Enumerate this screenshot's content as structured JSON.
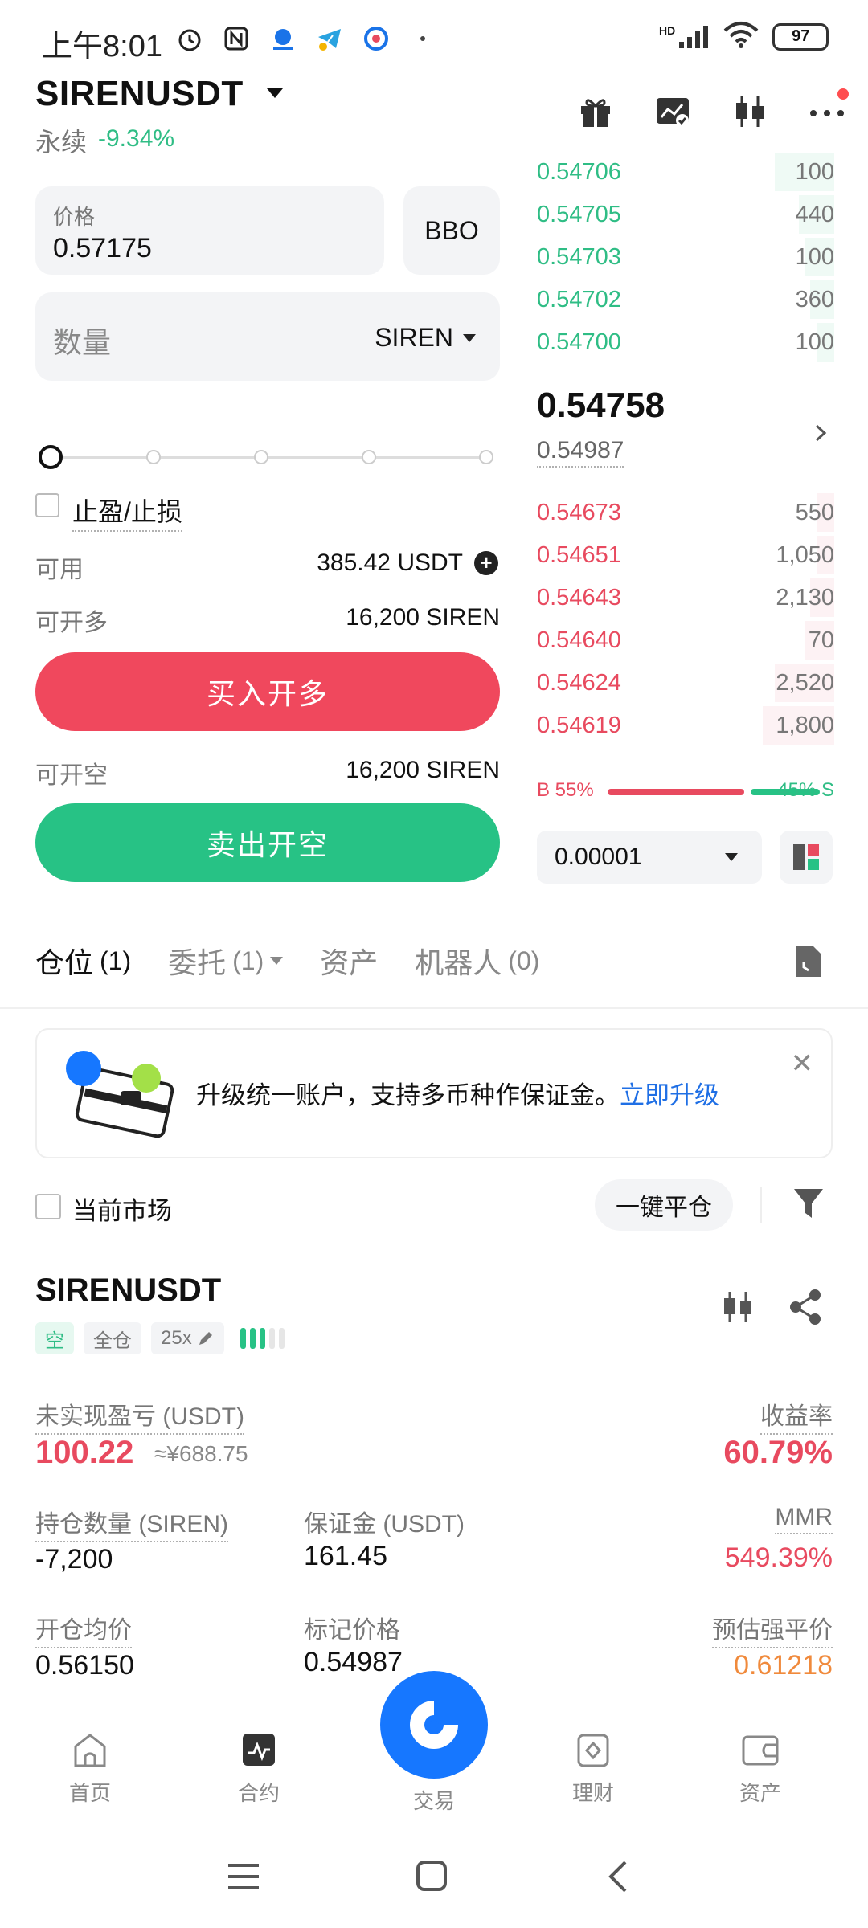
{
  "status_bar": {
    "time": "上午8:01",
    "battery": "97",
    "network": "HD"
  },
  "header": {
    "pair": "SIRENUSDT",
    "type": "永续",
    "change": "-9.34%"
  },
  "order_form": {
    "price_label": "价格",
    "price_value": "0.57175",
    "bbo_label": "BBO",
    "qty_placeholder": "数量",
    "qty_unit": "SIREN",
    "tpsl_label": "止盈/止损",
    "available_label": "可用",
    "available_value": "385.42 USDT",
    "long_label": "可开多",
    "long_value": "16,200 SIREN",
    "buy_label": "买入开多",
    "short_label": "可开空",
    "short_value": "16,200 SIREN",
    "sell_label": "卖出开空"
  },
  "order_book": {
    "asks_top": [
      {
        "price": "0.54706",
        "qty": "100",
        "depth": 0.2
      },
      {
        "price": "0.54705",
        "qty": "440",
        "depth": 0.12
      },
      {
        "price": "0.54703",
        "qty": "100",
        "depth": 0.1
      },
      {
        "price": "0.54702",
        "qty": "360",
        "depth": 0.08
      },
      {
        "price": "0.54700",
        "qty": "100",
        "depth": 0.06
      }
    ],
    "last_price": "0.54758",
    "mark_price": "0.54987",
    "bids": [
      {
        "price": "0.54673",
        "qty": "550",
        "depth": 0.06
      },
      {
        "price": "0.54651",
        "qty": "1,050",
        "depth": 0.06
      },
      {
        "price": "0.54643",
        "qty": "2,130",
        "depth": 0.08
      },
      {
        "price": "0.54640",
        "qty": "70",
        "depth": 0.1
      },
      {
        "price": "0.54624",
        "qty": "2,520",
        "depth": 0.2
      },
      {
        "price": "0.54619",
        "qty": "1,800",
        "depth": 0.24
      }
    ],
    "ratio_b": "B 55%",
    "ratio_s": "45% S",
    "tick_size": "0.00001"
  },
  "tabs": [
    {
      "label": "仓位",
      "count": "(1)",
      "active": true,
      "dropdown": false
    },
    {
      "label": "委托",
      "count": "(1)",
      "active": false,
      "dropdown": true
    },
    {
      "label": "资产",
      "count": "",
      "active": false,
      "dropdown": false
    },
    {
      "label": "机器人",
      "count": "(0)",
      "active": false,
      "dropdown": false
    }
  ],
  "banner": {
    "text": "升级统一账户，支持多币种作保证金。",
    "link": "立即升级"
  },
  "filters": {
    "current_market": "当前市场",
    "close_all": "一键平仓"
  },
  "position": {
    "symbol": "SIRENUSDT",
    "side_tag": "空",
    "margin_mode": "全仓",
    "leverage": "25x",
    "upnl_label": "未实现盈亏 (USDT)",
    "upnl_value": "100.22",
    "upnl_cny": "≈¥688.75",
    "roe_label": "收益率",
    "roe_value": "60.79%",
    "size_label": "持仓数量 (SIREN)",
    "size_value": "-7,200",
    "margin_label": "保证金 (USDT)",
    "margin_value": "161.45",
    "mmr_label": "MMR",
    "mmr_value": "549.39%",
    "entry_label": "开仓均价",
    "entry_value": "0.56150",
    "markp_label": "标记价格",
    "markp_value": "0.54987",
    "liq_label": "预估强平价",
    "liq_value": "0.61218"
  },
  "bottom_nav": {
    "home": "首页",
    "futures": "合约",
    "trade": "交易",
    "finance": "理财",
    "assets": "资产"
  },
  "colors": {
    "buy": "#f0485d",
    "sell": "#27c285",
    "accent": "#1677ff",
    "liq": "#f08a3c"
  }
}
